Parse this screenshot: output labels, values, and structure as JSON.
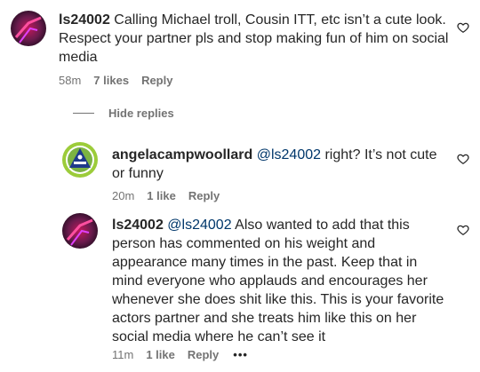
{
  "comments": [
    {
      "username": "ls24002",
      "text": "Calling Michael troll, Cousin ITT, etc isn’t a cute look. Respect your partner pls and stop making fun of him on social media",
      "time": "58m",
      "likes": "7 likes",
      "reply_label": "Reply"
    }
  ],
  "hide_replies_label": "Hide replies",
  "replies": [
    {
      "username": "angelacampwoollard",
      "mention": "@ls24002",
      "text": "right? It’s not cute or funny",
      "time": "20m",
      "likes": "1 like",
      "reply_label": "Reply"
    },
    {
      "username": "ls24002",
      "mention": "@ls24002",
      "text": "Also wanted to add that this person has commented on his weight and appearance many times in the past. Keep that in mind everyone who applauds and encourages her whenever she does shit like this. This is your favorite actors partner and she treats him like this on her social media where he can’t see it",
      "time": "11m",
      "likes": "1 like",
      "reply_label": "Reply",
      "more_label": "•••"
    }
  ],
  "icons": {
    "like": "heart-outline-icon",
    "more": "more-options-icon"
  },
  "colors": {
    "text": "#262626",
    "meta": "#737373",
    "mention": "#00376b"
  }
}
